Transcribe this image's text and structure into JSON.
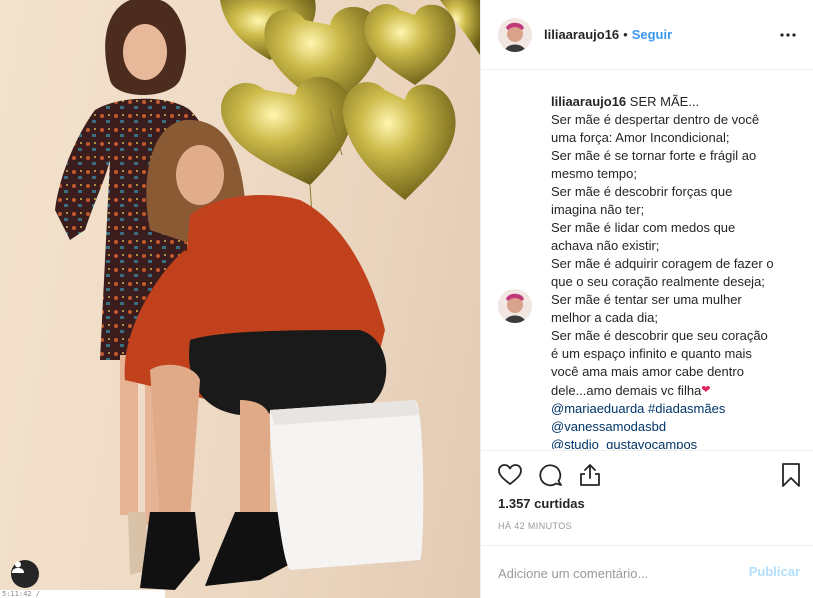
{
  "post": {
    "username": "liliaaraujo16",
    "separator": "•",
    "follow_label": "Seguir",
    "more_icon": "more-options-icon"
  },
  "caption": {
    "username": "liliaaraujo16",
    "first_line": "SER MÃE...",
    "lines": [
      "Ser mãe é despertar dentro de você",
      "uma força: Amor Incondicional;",
      "Ser mãe é se tornar forte e frágil ao",
      "mesmo tempo;",
      "Ser mãe é descobrir forças que",
      "imagina não ter;",
      "Ser mãe é lidar com medos que",
      "achava não existir;",
      "Ser mãe é adquirir coragem de fazer o",
      "que o seu coração realmente deseja;",
      "Ser mãe é tentar ser uma mulher",
      "melhor a cada dia;",
      "Ser mãe é descobrir que seu coração",
      "é um espaço infinito e quanto mais",
      "você ama mais amor cabe dentro"
    ],
    "last_line": "dele...amo demais vc filha",
    "heart_emoji": "❤",
    "tags": [
      "@mariaeduarda #diadasmães",
      "@vanessamodasbd",
      "@studio_gustavocampos"
    ]
  },
  "actions": {
    "likes_text": "1.357 curtidas",
    "time_text": "HÁ 42 MINUTOS",
    "icons": [
      "heart-icon",
      "comment-icon",
      "share-icon",
      "bookmark-icon"
    ]
  },
  "comment_box": {
    "placeholder": "Adicione um comentário...",
    "post_label": "Publicar"
  },
  "photo": {
    "tag_icon": "user-tag-icon",
    "strip_text": "5:11:42 /"
  },
  "colors": {
    "link": "#3897f0",
    "hashtag": "#003569",
    "post_disabled": "#b2dffc",
    "balloon_gold": "#b9a53a"
  }
}
